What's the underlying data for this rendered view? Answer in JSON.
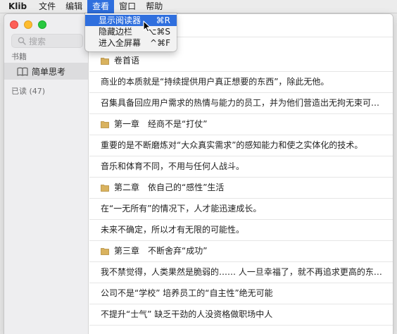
{
  "menubar": {
    "app_name": "Klib",
    "menus": [
      "文件",
      "编辑",
      "查看",
      "窗口",
      "帮助"
    ],
    "active_menu": "查看"
  },
  "view_menu": {
    "items": [
      {
        "label": "显示阅读器",
        "shortcut": "⌘R",
        "highlighted": true
      },
      {
        "label": "隐藏边栏",
        "shortcut": "⌥⌘S",
        "highlighted": false
      },
      {
        "label": "进入全屏幕",
        "shortcut": "^⌘F",
        "highlighted": false
      }
    ]
  },
  "sidebar": {
    "search_placeholder": "搜索",
    "books_section": "书籍",
    "books": [
      {
        "title": "简单思考"
      }
    ],
    "read_section": "已读 (47)"
  },
  "content": {
    "rows": [
      {
        "type": "chapter",
        "text": "卷首语"
      },
      {
        "type": "item",
        "text": "商业的本质就是“持续提供用户真正想要的东西”，除此无他。"
      },
      {
        "type": "item",
        "text": "召集具备回应用户需求的热情与能力的员工，并为他们营造出无拘无束可最大限度发挥能力的环境"
      },
      {
        "type": "chapter",
        "text": "第一章　经商不是“打仗”"
      },
      {
        "type": "item",
        "text": "重要的是不断磨炼对“大众真实需求”的感知能力和使之实体化的技术。"
      },
      {
        "type": "item",
        "text": "音乐和体育不同，不用与任何人战斗。"
      },
      {
        "type": "chapter",
        "text": "第二章　依自己的“感性”生活"
      },
      {
        "type": "item",
        "text": "在“一无所有”的情况下，人才能迅速成长。"
      },
      {
        "type": "item",
        "text": "未来不确定，所以才有无限的可能性。"
      },
      {
        "type": "chapter",
        "text": "第三章　不断舍弃“成功”"
      },
      {
        "type": "item",
        "text": "我不禁觉得，人类果然是脆弱的…… 人一旦幸福了，就不再追求更高的东西。"
      },
      {
        "type": "item",
        "text": "公司不是“学校” 培养员工的“自主性”绝无可能"
      },
      {
        "type": "item",
        "text": "不提升“士气” 缺乏干劲的人没资格做职场中人"
      }
    ]
  },
  "colors": {
    "accent": "#2f6fde",
    "folder": "#d9b25e"
  }
}
